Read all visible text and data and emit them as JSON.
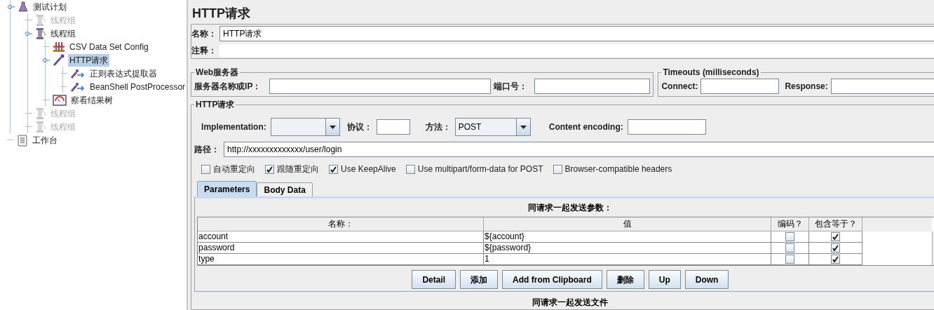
{
  "tree": [
    {
      "label": "测试计划",
      "kind": "plan",
      "disabled": false,
      "selected": false,
      "children": [
        {
          "label": "线程组",
          "kind": "threads",
          "disabled": true,
          "selected": false
        },
        {
          "label": "线程组",
          "kind": "threads",
          "disabled": false,
          "selected": false,
          "children": [
            {
              "label": "CSV Data Set Config",
              "kind": "config",
              "disabled": false,
              "selected": false
            },
            {
              "label": "HTTP请求",
              "kind": "sampler",
              "disabled": false,
              "selected": true,
              "children": [
                {
                  "label": "正则表达式提取器",
                  "kind": "post",
                  "disabled": false,
                  "selected": false
                },
                {
                  "label": "BeanShell PostProcessor",
                  "kind": "post",
                  "disabled": false,
                  "selected": false
                }
              ]
            },
            {
              "label": "察看结果树",
              "kind": "listener",
              "disabled": false,
              "selected": false
            }
          ]
        },
        {
          "label": "线程组",
          "kind": "threads",
          "disabled": true,
          "selected": false
        },
        {
          "label": "线程组",
          "kind": "threads",
          "disabled": true,
          "selected": false
        }
      ]
    },
    {
      "label": "工作台",
      "kind": "workbench",
      "disabled": false,
      "selected": false
    }
  ],
  "title": "HTTP请求",
  "name": {
    "label": "名称：",
    "value": "HTTP请求"
  },
  "comment": {
    "label": "注释："
  },
  "web_server": {
    "title": "Web服务器",
    "host_label": "服务器名称或IP：",
    "port_label": "端口号："
  },
  "timeouts": {
    "title": "Timeouts (milliseconds)",
    "connect_label": "Connect:",
    "response_label": "Response:"
  },
  "http": {
    "title": "HTTP请求",
    "implementation_label": "Implementation:",
    "protocol_label": "协议：",
    "method_label": "方法：",
    "method": "POST",
    "encoding_label": "Content encoding:",
    "path_label": "路径：",
    "path": "http://xxxxxxxxxxxxx/user/login",
    "options": [
      {
        "label": "自动重定向",
        "checked": false
      },
      {
        "label": "跟随重定向",
        "checked": true
      },
      {
        "label": "Use KeepAlive",
        "checked": true
      },
      {
        "label": "Use multipart/form-data for POST",
        "checked": false
      },
      {
        "label": "Browser-compatible headers",
        "checked": false
      }
    ]
  },
  "tabs": [
    {
      "label": "Parameters",
      "selected": true
    },
    {
      "label": "Body Data",
      "selected": false
    }
  ],
  "params": {
    "title": "同请求一起发送参数：",
    "columns": [
      "名称：",
      "值",
      "编码？",
      "包含等于？"
    ],
    "rows": [
      {
        "name": "account",
        "value": "${account}",
        "encode": false,
        "include_equals": true
      },
      {
        "name": "password",
        "value": "${password}",
        "encode": false,
        "include_equals": true
      },
      {
        "name": "type",
        "value": "1",
        "encode": false,
        "include_equals": true
      }
    ]
  },
  "buttons": [
    "Detail",
    "添加",
    "Add from Clipboard",
    "删除",
    "Up",
    "Down"
  ],
  "files_title": "同请求一起发送文件"
}
